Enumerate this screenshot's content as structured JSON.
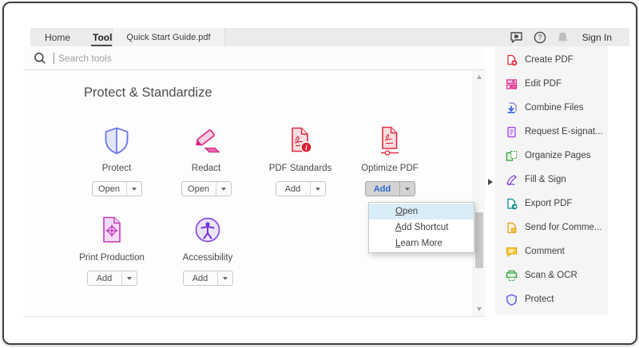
{
  "titlebar": {
    "tabs": {
      "home": "Home",
      "tools": "Tools",
      "document": "Quick Start Guide.pdf"
    },
    "sign_in_label": "Sign In"
  },
  "search": {
    "placeholder": "Search tools"
  },
  "main": {
    "section_title": "Protect & Standardize",
    "tools": [
      {
        "name": "Protect",
        "action": "Open"
      },
      {
        "name": "Redact",
        "action": "Open"
      },
      {
        "name": "PDF Standards",
        "action": "Add"
      },
      {
        "name": "Optimize PDF",
        "action": "Add"
      },
      {
        "name": "Print Production",
        "action": "Add"
      },
      {
        "name": "Accessibility",
        "action": "Add"
      }
    ],
    "context_menu": {
      "items": [
        "Open",
        "Add Shortcut",
        "Learn More"
      ],
      "highlighted_item": "Open"
    }
  },
  "sidebar": {
    "items": [
      "Create PDF",
      "Edit PDF",
      "Combine Files",
      "Request E-signat...",
      "Organize Pages",
      "Fill & Sign",
      "Export PDF",
      "Send for Comme...",
      "Comment",
      "Scan & OCR",
      "Protect"
    ]
  },
  "colors": {
    "accent_blue": "#2e67c8",
    "menu_highlight": "#d9edf8",
    "acrobat_red": "#dd2f41",
    "redact_pink": "#d62a84",
    "print_magenta": "#bf3cbf",
    "accessibility_purple": "#8a4ae6",
    "shield_blue": "#6673e9",
    "topbar_bg": "#ebebeb",
    "sidebar_bg": "#f5f5f5"
  }
}
